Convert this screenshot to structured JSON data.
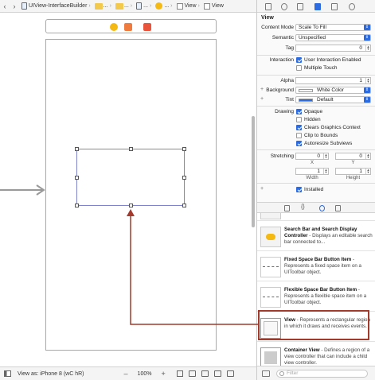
{
  "jumpbar": {
    "back": "‹",
    "forward": "›",
    "project": "UIView-InterfaceBuilder",
    "ellipsis1": "...",
    "ellipsis2": "...",
    "ellipsis3": "...",
    "view": "View",
    "view2": "View"
  },
  "statusbar": {
    "view_as": "View as: iPhone 8 (wC hR)",
    "zoom_out": "–",
    "zoom": "100%",
    "zoom_in": "+"
  },
  "inspector": {
    "view_title": "View",
    "content_mode_label": "Content Mode",
    "content_mode": "Scale To Fill",
    "semantic_label": "Semantic",
    "semantic": "Unspecified",
    "tag_label": "Tag",
    "tag": "0",
    "interaction_label": "Interaction",
    "user_interaction": "User Interaction Enabled",
    "multiple_touch": "Multiple Touch",
    "alpha_label": "Alpha",
    "alpha": "1",
    "background_label": "Background",
    "background": "White Color",
    "tint_label": "Tint",
    "tint": "Default",
    "drawing_label": "Drawing",
    "opaque": "Opaque",
    "hidden": "Hidden",
    "clears_graphics": "Clears Graphics Context",
    "clip_to_bounds": "Clip to Bounds",
    "autoresize": "Autoresize Subviews",
    "stretching_label": "Stretching",
    "stretch_x": "0",
    "stretch_y": "0",
    "stretch_width": "1",
    "stretch_height": "1",
    "x_label": "X",
    "y_label": "Y",
    "width_label": "Width",
    "height_label": "Height",
    "installed": "Installed",
    "plus": "+"
  },
  "library": {
    "items": [
      {
        "title": "Search Bar and Search Display Controller",
        "desc": " - Displays an editable search bar connected to..."
      },
      {
        "title": "Fixed Space Bar Button Item",
        "desc": " - Represents a fixed space item on a UIToolbar object."
      },
      {
        "title": "Flexible Space Bar Button Item",
        "desc": " - Represents a flexible space item on a UIToolbar object."
      },
      {
        "title": "View",
        "desc": " - Represents a rectangular region in which it draws and receives events."
      },
      {
        "title": "Container View",
        "desc": " - Defines a region of a view controller that can include a child view controller."
      }
    ],
    "filter_placeholder": "Filter"
  },
  "colors": {
    "accent": "#2c6ce0",
    "highlight": "#a33a2c",
    "selection_border": "#7f83c9"
  }
}
